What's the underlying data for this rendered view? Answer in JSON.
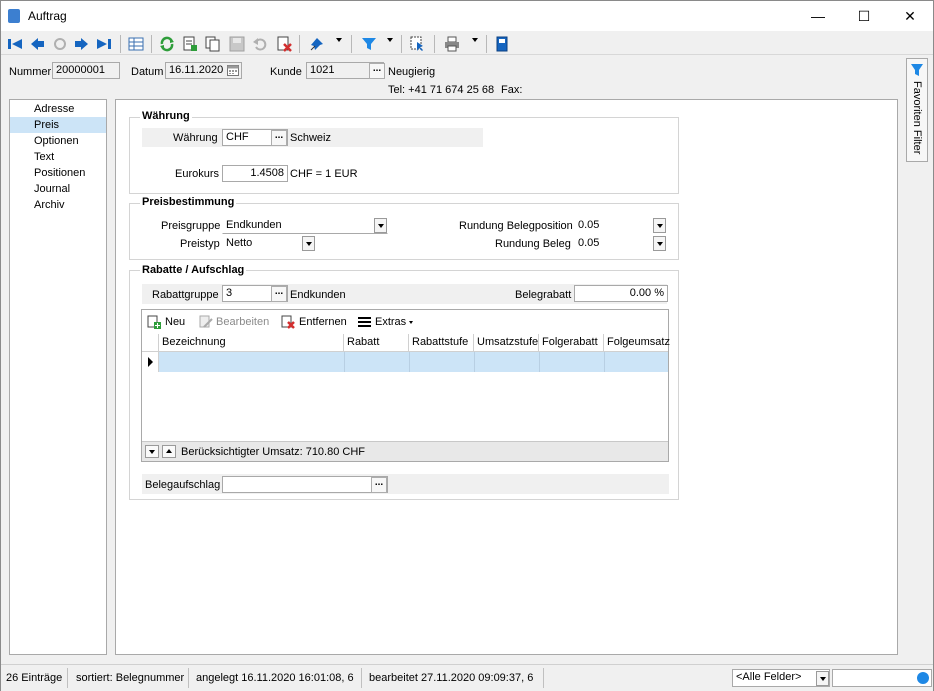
{
  "window": {
    "title": "Auftrag",
    "minimize": "—",
    "maximize": "☐",
    "close": "✕"
  },
  "toolbar": {
    "buttons": [
      "first-record",
      "previous-record",
      "refresh-record",
      "next-record",
      "last-record",
      "table-view",
      "reload",
      "new-document",
      "copy",
      "save",
      "undo",
      "delete",
      "pin",
      "filter",
      "select",
      "print",
      "book"
    ]
  },
  "header": {
    "nummer_label": "Nummer",
    "nummer_value": "20000001",
    "datum_label": "Datum",
    "datum_value": "16.11.2020",
    "kunde_label": "Kunde",
    "kunde_value": "1021",
    "kunde_name": "Neugierig",
    "kunde_dots": "...",
    "tel": "Tel: +41 71 674 25 68",
    "fax": "Fax:"
  },
  "nav": {
    "items": [
      "Adresse",
      "Preis",
      "Optionen",
      "Text",
      "Positionen",
      "Journal",
      "Archiv"
    ],
    "selected": "Preis"
  },
  "waehrung": {
    "title": "Währung",
    "waehrung_label": "Währung",
    "waehrung_value": "CHF",
    "waehrung_dots": "...",
    "waehrung_name": "Schweiz",
    "eurokurs_label": "Eurokurs",
    "eurokurs_value": "1.4508",
    "eurokurs_unit": "CHF = 1 EUR"
  },
  "preisbestimmung": {
    "title": "Preisbestimmung",
    "preisgruppe_label": "Preisgruppe",
    "preisgruppe_value": "Endkunden",
    "preistyp_label": "Preistyp",
    "preistyp_value": "Netto",
    "rundung_pos_label": "Rundung Belegposition",
    "rundung_pos_value": "0.05",
    "rundung_beleg_label": "Rundung Beleg",
    "rundung_beleg_value": "0.05"
  },
  "rabatte": {
    "title": "Rabatte / Aufschlag",
    "rabattgruppe_label": "Rabattgruppe",
    "rabattgruppe_value": "3",
    "rabattgruppe_dots": "...",
    "rabattgruppe_name": "Endkunden",
    "belegrabatt_label": "Belegrabatt",
    "belegrabatt_value": "0.00 %",
    "grid_toolbar": {
      "neu": "Neu",
      "bearbeiten": "Bearbeiten",
      "entfernen": "Entfernen",
      "extras": "Extras"
    },
    "columns": [
      "Bezeichnung",
      "Rabatt",
      "Rabattstufe",
      "Umsatzstufe",
      "Folgerabatt",
      "Folgeumsatz"
    ],
    "footer": "Berücksichtigter Umsatz: 710.80 CHF",
    "belegaufschlag_label": "Belegaufschlag",
    "belegaufschlag_dots": "..."
  },
  "sidebar": {
    "label": "Favoriten Filter"
  },
  "status": {
    "count": "26 Einträge",
    "sort": "sortiert: Belegnummer",
    "created": "angelegt 16.11.2020 16:01:08,  6",
    "edited": "bearbeitet 27.11.2020 09:09:37,  6",
    "field_select": "<Alle Felder>"
  },
  "colors": {
    "accent": "#1565c0",
    "selection": "#cce4f7",
    "green": "#2e9d3a",
    "red": "#d32f2f"
  }
}
